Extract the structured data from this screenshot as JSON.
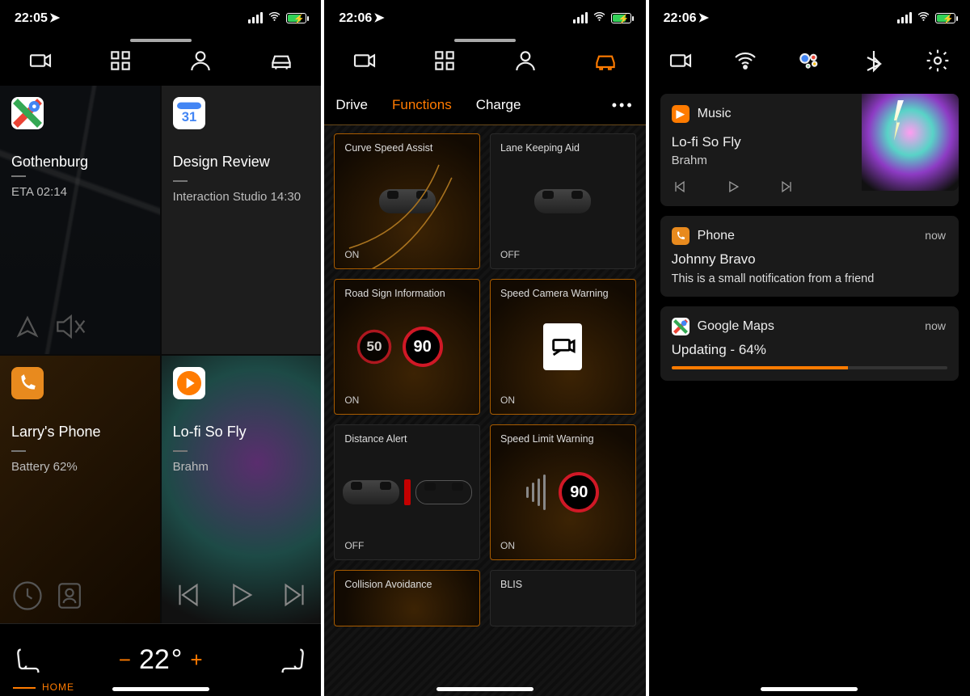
{
  "screen1": {
    "clock": "22:05",
    "tiles": {
      "maps": {
        "title": "Gothenburg",
        "sub": "ETA 02:14"
      },
      "cal": {
        "title": "Design Review",
        "sub": "Interaction Studio 14:30",
        "cal_day": "31"
      },
      "phone": {
        "title": "Larry's Phone",
        "sub": "Battery 62%"
      },
      "music": {
        "title": "Lo-fi So Fly",
        "sub": "Brahm"
      }
    },
    "climate": {
      "temp": "22",
      "deg": "°",
      "label": "HOME"
    }
  },
  "screen2": {
    "clock": "22:06",
    "tabs": {
      "drive": "Drive",
      "functions": "Functions",
      "charge": "Charge"
    },
    "cards": [
      {
        "title": "Curve Speed Assist",
        "state": "ON"
      },
      {
        "title": "Lane Keeping Aid",
        "state": "OFF"
      },
      {
        "title": "Road Sign Information",
        "state": "ON",
        "speed_a": "50",
        "speed_b": "90"
      },
      {
        "title": "Speed Camera Warning",
        "state": "ON"
      },
      {
        "title": "Distance Alert",
        "state": "OFF"
      },
      {
        "title": "Speed Limit Warning",
        "state": "ON",
        "speed": "90"
      },
      {
        "title": "Collision Avoidance",
        "state": ""
      },
      {
        "title": "BLIS",
        "state": ""
      }
    ]
  },
  "screen3": {
    "clock": "22:06",
    "music": {
      "app": "Music",
      "track": "Lo-fi So Fly",
      "artist": "Brahm"
    },
    "phone": {
      "app": "Phone",
      "time": "now",
      "title": "Johnny Bravo",
      "text": "This is a small notification from a friend"
    },
    "maps": {
      "app": "Google Maps",
      "time": "now",
      "title": "Updating - 64%",
      "progress": 64
    }
  }
}
